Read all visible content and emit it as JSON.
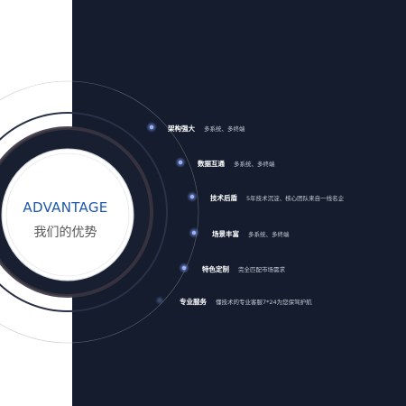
{
  "heading": {
    "title": "ADVANTAGE",
    "subtitle": "我们的优势"
  },
  "advantages": [
    {
      "label": "架构强大",
      "description": "多系统、多终端"
    },
    {
      "label": "数据互通",
      "description": "多系统、多终端"
    },
    {
      "label": "技术后盾",
      "description": "5年技术沉淀、核心团队来自一线名企"
    },
    {
      "label": "场景丰富",
      "description": "多系统、多终端"
    },
    {
      "label": "特色定制",
      "description": "完全匹配市场需求"
    },
    {
      "label": "专业服务",
      "description": "懂技术的专业客服7*24为您保驾护航"
    }
  ],
  "colors": {
    "panel_background": "#141c2e",
    "accent_blue": "#1c56b0",
    "dot_color": "#7b93ec"
  }
}
